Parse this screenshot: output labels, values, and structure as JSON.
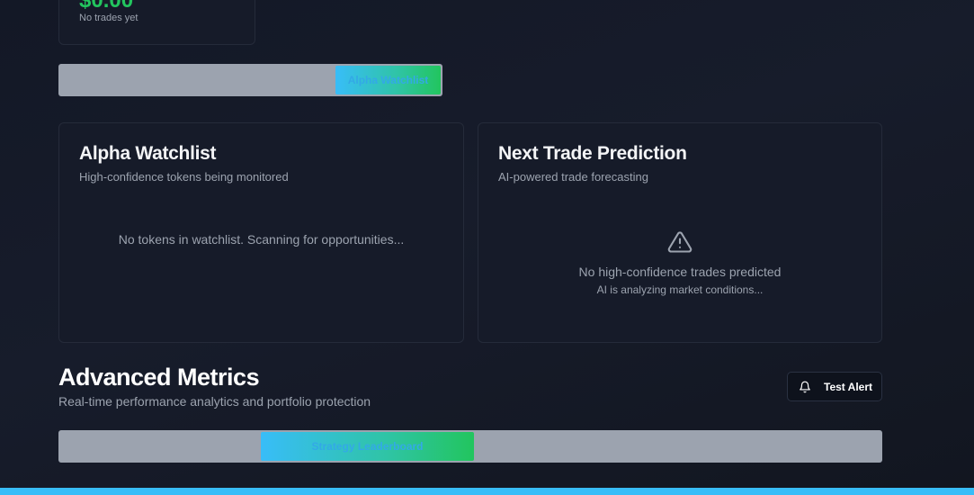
{
  "stat": {
    "value": "$0.00",
    "subtitle": "No trades yet"
  },
  "tabs_top": {
    "active_label": "Alpha Watchlist"
  },
  "watchlist": {
    "title": "Alpha Watchlist",
    "subtitle": "High-confidence tokens being monitored",
    "empty_message": "No tokens in watchlist. Scanning for opportunities..."
  },
  "prediction": {
    "title": "Next Trade Prediction",
    "subtitle": "AI-powered trade forecasting",
    "empty_message": "No high-confidence trades predicted",
    "empty_sub": "AI is analyzing market conditions...",
    "icon": "warning-icon"
  },
  "advanced": {
    "title": "Advanced Metrics",
    "subtitle": "Real-time performance analytics and portfolio protection",
    "test_alert_label": "Test Alert",
    "test_alert_icon": "bell-icon"
  },
  "tabs_bottom": {
    "active_label": "Strategy Leaderboard"
  },
  "colors": {
    "accent_green": "#22c55e",
    "accent_blue": "#38bdf8",
    "background": "#131826",
    "card": "#161b29"
  }
}
